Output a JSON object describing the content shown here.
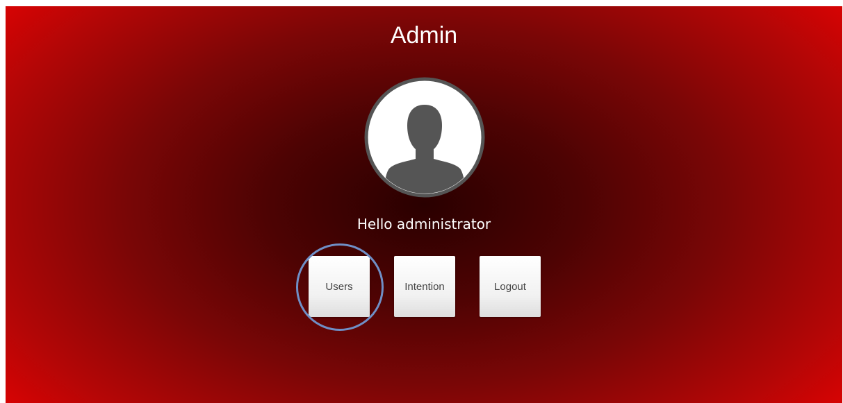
{
  "header": {
    "title": "Admin"
  },
  "profile": {
    "greeting": "Hello administrator",
    "avatar_icon": "user-silhouette-icon"
  },
  "menu": {
    "items": [
      {
        "label": "Users",
        "highlighted": true
      },
      {
        "label": "Intention",
        "highlighted": false
      },
      {
        "label": "Logout",
        "highlighted": false
      }
    ]
  },
  "colors": {
    "background_edge": "#ff0000",
    "background_center": "#2a0000",
    "highlight_ring": "#6f8fc6",
    "avatar_gray": "#555555"
  }
}
